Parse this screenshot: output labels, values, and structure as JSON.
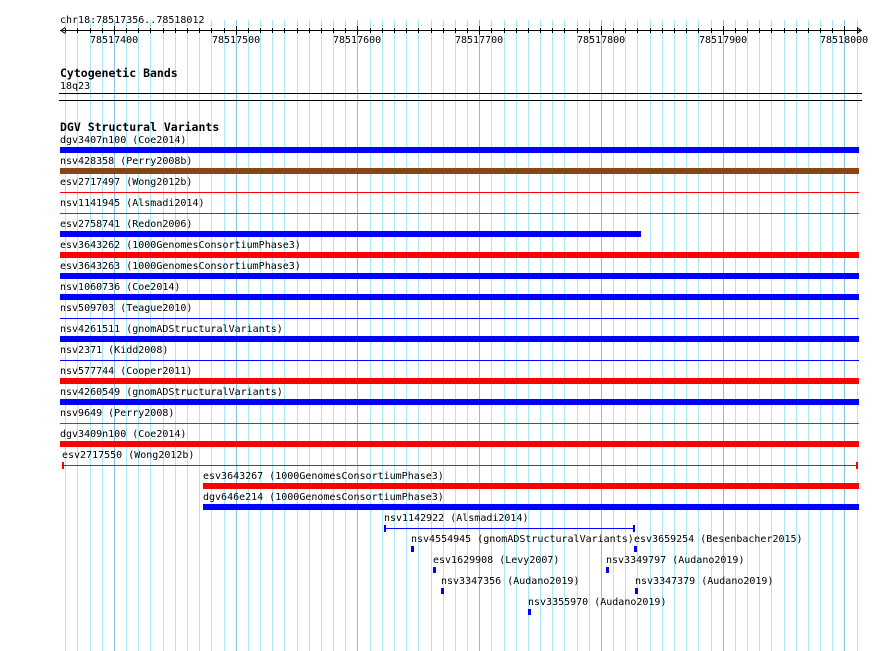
{
  "region": {
    "label": "chr18:78517356..78518012",
    "start": 78517356,
    "end": 78518012
  },
  "ruler": {
    "tick_labels": [
      "78517400",
      "78517500",
      "78517600",
      "78517700",
      "78517800",
      "78517900",
      "78518000"
    ],
    "minor_tick_bp": 10,
    "left_arrow_icon": "arrow-left-icon",
    "right_arrow_icon": "arrow-right-icon"
  },
  "grid": {
    "minor_bp": 10,
    "major_bp": 100,
    "minor_color": "#a8e8f0",
    "major_color": "#88c0e8"
  },
  "cytoband_track": {
    "title": "Cytogenetic Bands",
    "band": "18q23"
  },
  "dgv_track": {
    "title": "DGV Structural Variants",
    "colors": {
      "blue": "#0000ff",
      "red": "#ff0000",
      "brown": "#8b4513"
    },
    "rows": [
      [
        {
          "label": "dgv3407n100 (Coe2014)",
          "start": 78517356,
          "end": 78518012,
          "color": "blue",
          "style": "thick"
        }
      ],
      [
        {
          "label": "nsv428358 (Perry2008b)",
          "start": 78517356,
          "end": 78518012,
          "color": "brown",
          "style": "thick"
        }
      ],
      [
        {
          "label": "esv2717497 (Wong2012b)",
          "start": 78517356,
          "end": 78518012,
          "color": "red",
          "style": "thin"
        }
      ],
      [
        {
          "label": "nsv1141945 (Alsmadi2014)",
          "start": 78517356,
          "end": 78518012,
          "color": "red",
          "style": "thin"
        }
      ],
      [
        {
          "label": "esv2758741 (Redon2006)",
          "start": 78517356,
          "end": 78517833,
          "color": "blue",
          "style": "thick"
        }
      ],
      [
        {
          "label": "esv3643262 (1000GenomesConsortiumPhase3)",
          "start": 78517356,
          "end": 78518012,
          "color": "red",
          "style": "thick"
        }
      ],
      [
        {
          "label": "esv3643263 (1000GenomesConsortiumPhase3)",
          "start": 78517356,
          "end": 78518012,
          "color": "blue",
          "style": "thick"
        }
      ],
      [
        {
          "label": "nsv1060736 (Coe2014)",
          "start": 78517356,
          "end": 78518012,
          "color": "blue",
          "style": "thick"
        }
      ],
      [
        {
          "label": "nsv509703 (Teague2010)",
          "start": 78517356,
          "end": 78518012,
          "color": "blue",
          "style": "thin"
        }
      ],
      [
        {
          "label": "nsv4261511 (gnomADStructuralVariants)",
          "start": 78517356,
          "end": 78518012,
          "color": "blue",
          "style": "thick"
        }
      ],
      [
        {
          "label": "nsv2371 (Kidd2008)",
          "start": 78517356,
          "end": 78518012,
          "color": "blue",
          "style": "thin"
        }
      ],
      [
        {
          "label": "nsv577744 (Cooper2011)",
          "start": 78517356,
          "end": 78518012,
          "color": "red",
          "style": "thick"
        }
      ],
      [
        {
          "label": "nsv4260549 (gnomADStructuralVariants)",
          "start": 78517356,
          "end": 78518012,
          "color": "blue",
          "style": "thick"
        }
      ],
      [
        {
          "label": "nsv9649 (Perry2008)",
          "start": 78517356,
          "end": 78518012,
          "color": "brown",
          "style": "thin"
        }
      ],
      [
        {
          "label": "dgv3409n100 (Coe2014)",
          "start": 78517356,
          "end": 78518012,
          "color": "red",
          "style": "thick"
        }
      ],
      [
        {
          "label": "esv2717550 (Wong2012b)",
          "start": 78517357,
          "end": 78518011,
          "color": "red",
          "style": "capped"
        }
      ],
      [
        {
          "label": "esv3643267 (1000GenomesConsortiumPhase3)",
          "start": 78517473,
          "end": 78518012,
          "color": "red",
          "style": "thick"
        }
      ],
      [
        {
          "label": "dgv646e214 (1000GenomesConsortiumPhase3)",
          "start": 78517473,
          "end": 78518012,
          "color": "blue",
          "style": "thick"
        }
      ],
      [
        {
          "label": "nsv1142922 (Alsmadi2014)",
          "start": 78517622,
          "end": 78517828,
          "color": "blue",
          "style": "capped"
        }
      ],
      [
        {
          "label": "nsv4554945 (gnomADStructuralVariants)",
          "start": 78517644,
          "end": 78517646,
          "color": "blue",
          "style": "thick"
        },
        {
          "label": "esv3659254 (Besenbacher2015)",
          "start": 78517827,
          "end": 78517829,
          "color": "blue",
          "style": "thick"
        }
      ],
      [
        {
          "label": "esv1629908 (Levy2007)",
          "start": 78517662,
          "end": 78517664,
          "color": "blue",
          "style": "thick"
        },
        {
          "label": "nsv3349797 (Audano2019)",
          "start": 78517804,
          "end": 78517806,
          "color": "blue",
          "style": "thick"
        }
      ],
      [
        {
          "label": "nsv3347356 (Audano2019)",
          "start": 78517669,
          "end": 78517671,
          "color": "blue",
          "style": "thick"
        },
        {
          "label": "nsv3347379 (Audano2019)",
          "start": 78517828,
          "end": 78517830,
          "color": "blue",
          "style": "thick"
        }
      ],
      [
        {
          "label": "nsv3355970 (Audano2019)",
          "start": 78517740,
          "end": 78517742,
          "color": "blue",
          "style": "thick"
        }
      ]
    ]
  }
}
